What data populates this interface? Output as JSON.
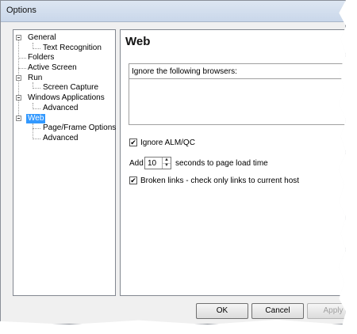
{
  "window": {
    "title": "Options"
  },
  "tree": {
    "items": [
      {
        "label": "General"
      },
      {
        "label": "Text Recognition"
      },
      {
        "label": "Folders"
      },
      {
        "label": "Active Screen"
      },
      {
        "label": "Run"
      },
      {
        "label": "Screen Capture"
      },
      {
        "label": "Windows Applications"
      },
      {
        "label": "Advanced"
      },
      {
        "label": "Web",
        "selected": true
      },
      {
        "label": "Page/Frame Options"
      },
      {
        "label": "Advanced"
      }
    ]
  },
  "panel": {
    "title": "Web",
    "ignore_browsers_label": "Ignore the following browsers:",
    "ignore_alm_label": "Ignore ALM/QC",
    "ignore_alm_checked": true,
    "add_label": "Add",
    "seconds_value": "10",
    "seconds_label": "seconds to page load time",
    "broken_links_label": "Broken links - check only links to current host",
    "broken_links_checked": true
  },
  "buttons": {
    "ok": "OK",
    "cancel": "Cancel",
    "apply": "Apply"
  },
  "icons": {
    "checkbox_checked": "✔",
    "spin_up": "▲",
    "spin_down": "▼"
  }
}
